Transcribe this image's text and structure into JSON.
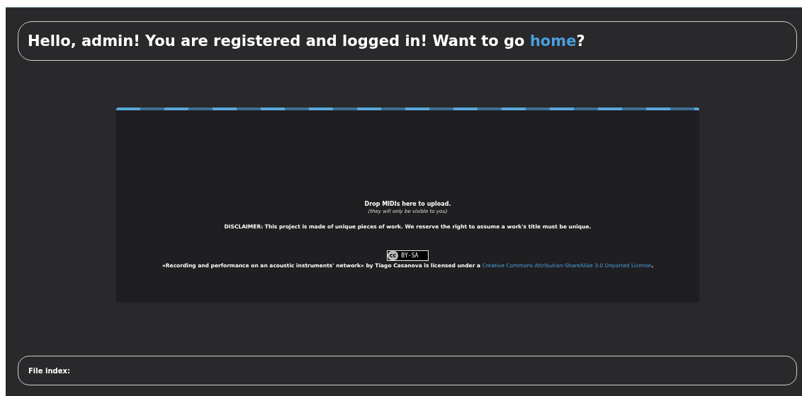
{
  "greeting": {
    "before": "Hello, admin! You are registered and logged in! Want to go ",
    "link": "home",
    "after": "?"
  },
  "dropzone": {
    "title": "Drop MIDIs here to upload.",
    "note": "(they will only be visible to you)",
    "disclaimer": "DISCLAIMER: This project is made of unique pieces of work. We reserve the right to assume a work's title must be unique.",
    "badge": {
      "mark": "cc",
      "label": "BY-SA"
    },
    "license": {
      "before": "«Recording and performance on an acoustic instruments' network» by Tiago Casanova is licensed under a ",
      "link": "Creative Commons Attribution-ShareAlike 3.0 Unported License",
      "after": "."
    }
  },
  "file_index": {
    "label": "File index:"
  }
}
